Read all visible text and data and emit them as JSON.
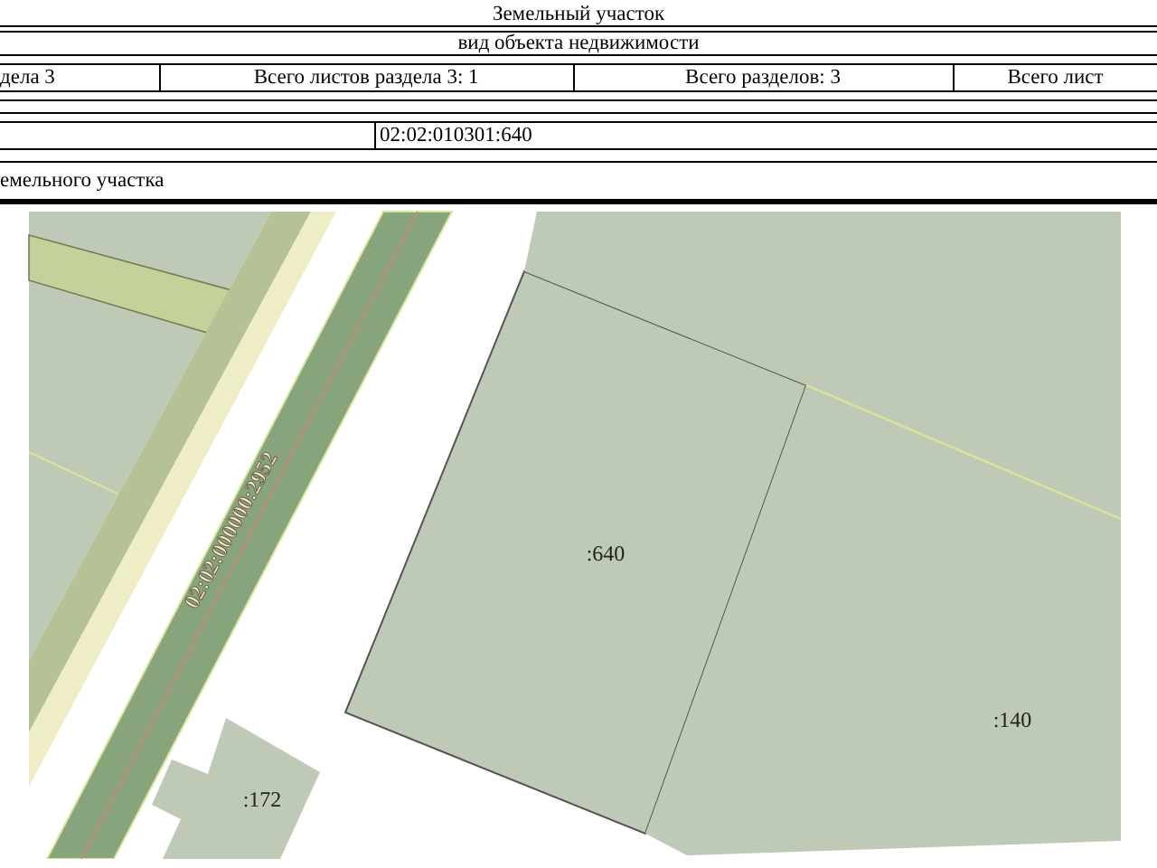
{
  "document": {
    "object_type": "Земельный участок",
    "object_type_caption": "вид объекта недвижимости",
    "sheet_info": [
      "дела 3",
      "Всего листов раздела 3: 1",
      "Всего разделов: 3",
      "Всего лист"
    ],
    "cadastral_number": "02:02:010301:640",
    "section_caption": "емельного участка"
  },
  "map": {
    "road_label": "02:02:000000:2952",
    "parcels": [
      {
        "label": ":640"
      },
      {
        "label": ":140"
      },
      {
        "label": ":172"
      }
    ]
  }
}
